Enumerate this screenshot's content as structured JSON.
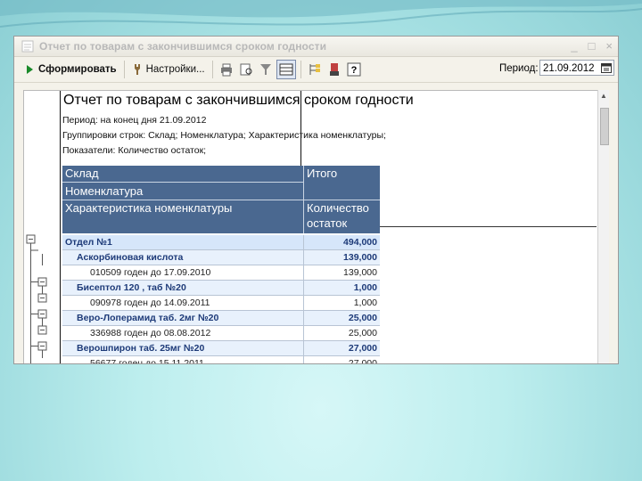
{
  "window": {
    "title": "Отчет по товарам с закончившимся сроком годности",
    "controls": [
      "_",
      "□",
      "×"
    ]
  },
  "toolbar": {
    "generate_label": "Сформировать",
    "settings_label": "Настройки...",
    "period_label": "Период:",
    "period_value": "21.09.2012"
  },
  "report": {
    "title": "Отчет по товарам с закончившимся сроком годности",
    "period_line": "Период: на конец дня 21.09.2012",
    "grouping_line": "Группировки строк: Склад; Номенклатура; Характеристика номенклатуры;",
    "indicators_line": "Показатели: Количество остаток;",
    "headers": {
      "warehouse": "Склад",
      "nomenclature": "Номенклатура",
      "characteristic": "Характеристика номенклатуры",
      "total": "Итого",
      "quantity_line1": "Количество",
      "quantity_line2": "остаток"
    },
    "rows": [
      {
        "level": 1,
        "name": "Отдел №1",
        "value": "494,000"
      },
      {
        "level": 2,
        "name": "Аскорбиновая кислота",
        "value": "139,000"
      },
      {
        "level": 3,
        "name": "010509 годен до 17.09.2010",
        "value": "139,000"
      },
      {
        "level": 2,
        "name": "Бисептол 120 , таб №20",
        "value": "1,000"
      },
      {
        "level": 3,
        "name": "090978 годен до 14.09.2011",
        "value": "1,000"
      },
      {
        "level": 2,
        "name": "Веро-Лоперамид таб. 2мг №20",
        "value": "25,000"
      },
      {
        "level": 3,
        "name": "336988 годен до 08.08.2012",
        "value": "25,000"
      },
      {
        "level": 2,
        "name": "Верошпирон таб. 25мг №20",
        "value": "27,000"
      },
      {
        "level": 3,
        "name": "56677 годен до 15.11.2011",
        "value": "27,000"
      }
    ]
  },
  "colors": {
    "header_bg": "#4a6890",
    "group1_bg": "#d6e6fa",
    "group2_bg": "#e8f1fc",
    "group_text": "#1d3a78"
  }
}
